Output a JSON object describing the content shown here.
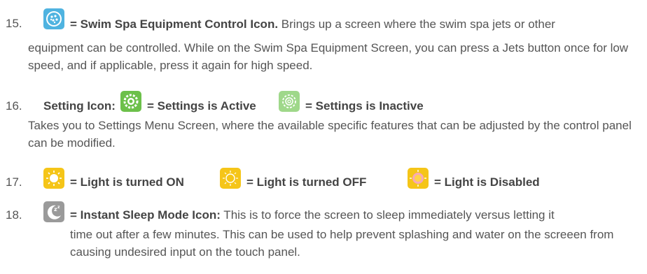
{
  "items": [
    {
      "number": "15.",
      "heading": "= Swim Spa Equipment Control Icon.",
      "heading_rest": " Brings up a screen where the swim spa jets or other",
      "body": "equipment can be controlled. While on the Swim Spa Equipment Screen, you can press a Jets button once for low speed, and if applicable, press it again for high speed.",
      "icon": "swim-spa-equipment-icon"
    },
    {
      "number": "16.",
      "label": "Setting Icon:",
      "active_label": "= Settings is Active",
      "inactive_label": "= Settings is Inactive",
      "body": "Takes you to Settings Menu Screen, where the available specific features that can be adjusted by the control panel can be modified.",
      "icons": [
        "settings-active-icon",
        "settings-inactive-icon"
      ]
    },
    {
      "number": "17.",
      "on_label": "= Light is turned ON",
      "off_label": "= Light is turned OFF",
      "disabled_label": "= Light is Disabled",
      "icons": [
        "light-on-icon",
        "light-off-icon",
        "light-disabled-icon"
      ]
    },
    {
      "number": "18.",
      "heading": "= Instant Sleep Mode Icon:",
      "heading_rest": " This is to force the screen to sleep immediately versus letting it",
      "body": "time out after a few minutes. This can be used to help prevent splashing and water on the screeen from causing undesired input on the touch panel.",
      "icon": "sleep-mode-icon"
    }
  ],
  "colors": {
    "text": "#555555",
    "blue_icon": "#4fb3e0",
    "green_icon": "#6cc04a",
    "green_inactive": "#9fd88a",
    "yellow_icon": "#f5c518",
    "gray_icon": "#9a9a9a"
  }
}
